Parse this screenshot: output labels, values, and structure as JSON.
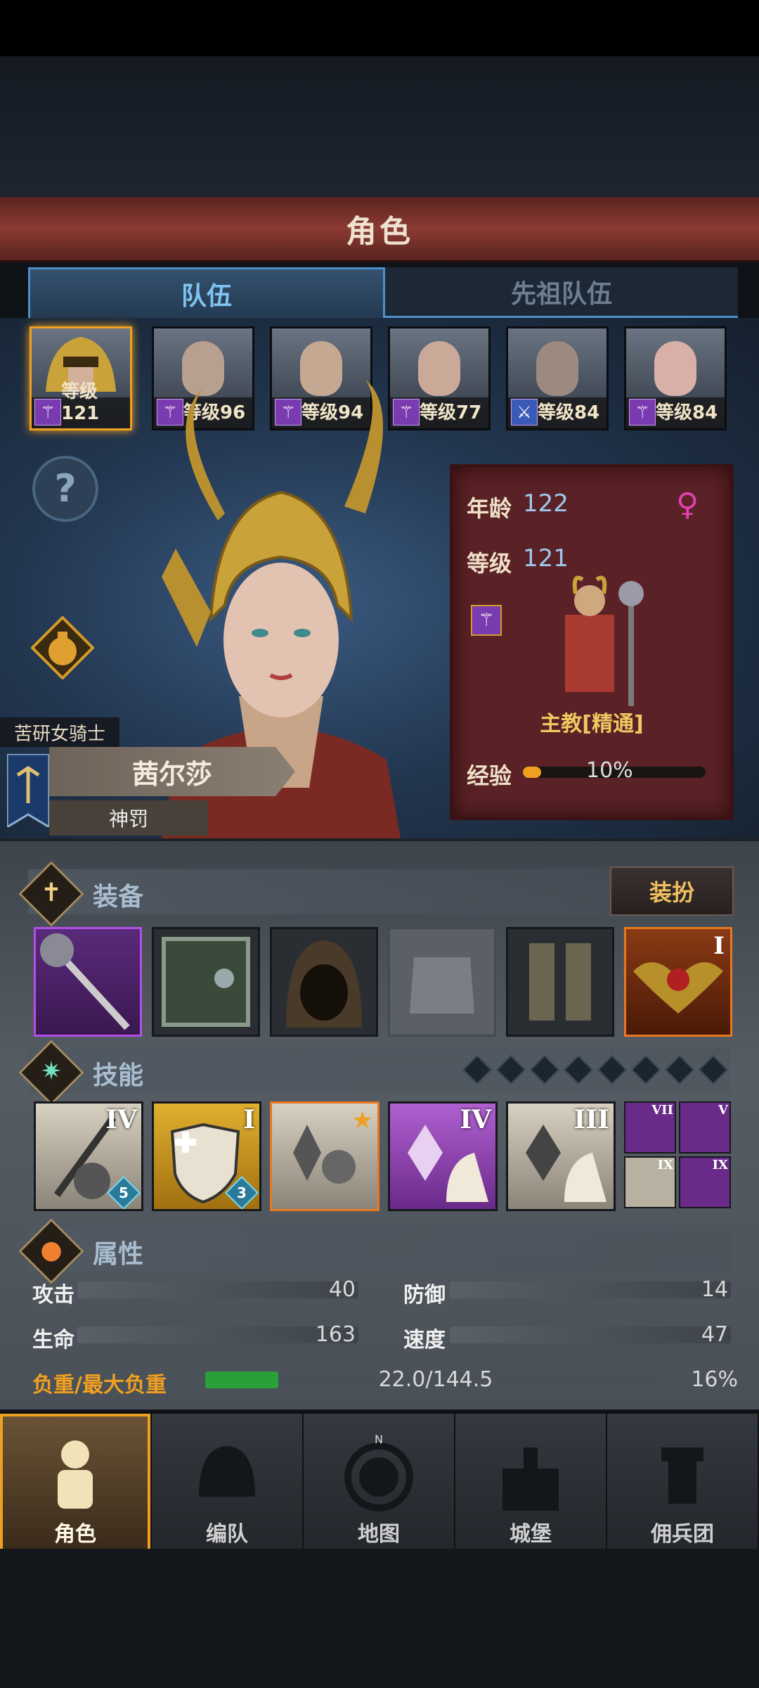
{
  "header": {
    "title": "角色"
  },
  "tabs": [
    {
      "label": "队伍",
      "active": true
    },
    {
      "label": "先祖队伍",
      "active": false
    }
  ],
  "roster": [
    {
      "level_text": "等级121",
      "selected": true
    },
    {
      "level_text": "等级96"
    },
    {
      "level_text": "等级94"
    },
    {
      "level_text": "等级77"
    },
    {
      "level_text": "等级84"
    },
    {
      "level_text": "等级84"
    }
  ],
  "hero": {
    "title": "苦研女骑士",
    "name": "茜尔莎",
    "subtitle": "神罚",
    "age_label": "年龄",
    "age": "122",
    "level_label": "等级",
    "level": "121",
    "class_name": "主教[精通]",
    "exp_label": "经验",
    "exp_percent_text": "10%",
    "exp_fraction": 0.1
  },
  "equipment": {
    "title": "装备",
    "dress_button": "装扮",
    "slots": [
      {
        "icon": "staff-icon",
        "rarity": "purple"
      },
      {
        "icon": "tome-icon",
        "rarity": "common"
      },
      {
        "icon": "hood-icon",
        "rarity": "common"
      },
      {
        "icon": "armor-icon",
        "rarity": "empty"
      },
      {
        "icon": "boots-icon",
        "rarity": "common"
      },
      {
        "icon": "bat-amulet-icon",
        "rarity": "orange",
        "tier": "I"
      }
    ]
  },
  "skills": {
    "title": "技能",
    "main": [
      {
        "roman": "IV",
        "badge": "5"
      },
      {
        "roman": "I",
        "badge": "3"
      },
      {
        "roman": "",
        "badge": ""
      },
      {
        "roman": "IV",
        "badge": ""
      },
      {
        "roman": "III",
        "badge": ""
      }
    ],
    "extra": [
      {
        "roman": "VII"
      },
      {
        "roman": "V"
      },
      {
        "roman": "IX"
      },
      {
        "roman": "IX"
      }
    ]
  },
  "attributes": {
    "title": "属性",
    "attack_label": "攻击",
    "attack": "40",
    "defense_label": "防御",
    "defense": "14",
    "hp_label": "生命",
    "hp": "163",
    "speed_label": "速度",
    "speed": "47",
    "load_label": "负重/最大负重",
    "load": "22.0/144.5",
    "load_percent": "16%",
    "load_fraction": 0.16
  },
  "nav": [
    {
      "label": "角色",
      "active": true
    },
    {
      "label": "编队"
    },
    {
      "label": "地图"
    },
    {
      "label": "城堡"
    },
    {
      "label": "佣兵团"
    }
  ],
  "colors": {
    "accent": "#f0a020",
    "tab_active": "#7fc4f0",
    "panel": "#5a2226"
  }
}
